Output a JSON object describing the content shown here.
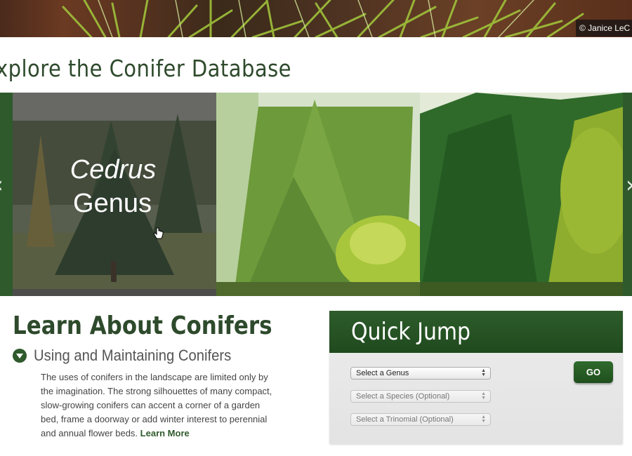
{
  "hero": {
    "photo_credit": "© Janice LeC"
  },
  "section": {
    "title": "xplore the Conifer Database"
  },
  "carousel": {
    "prev_icon": "chevron-left-icon",
    "next_icon": "chevron-right-icon",
    "tiles": [
      {
        "genus": "Cedrus",
        "label": "Genus"
      },
      {
        "genus": "",
        "label": ""
      },
      {
        "genus": "",
        "label": ""
      }
    ]
  },
  "learn": {
    "title": "Learn About Conifers",
    "accordion_title": "Using and Maintaining Conifers",
    "body": "The uses of conifers in the landscape are limited only by the imagination. The strong silhouettes of many compact, slow-growing conifers can accent a corner of a garden bed, frame a doorway or add winter interest to perennial and annual flower beds.",
    "learn_more": "Learn More"
  },
  "quick_jump": {
    "title": "Quick Jump",
    "genus_select": "Select a Genus",
    "species_select": "Select a Species (Optional)",
    "trinomial_select": "Select a Trinomial (Optional)",
    "go_label": "GO"
  },
  "colors": {
    "brand_green": "#2f5a2c",
    "heading_green": "#2e4a2c"
  }
}
